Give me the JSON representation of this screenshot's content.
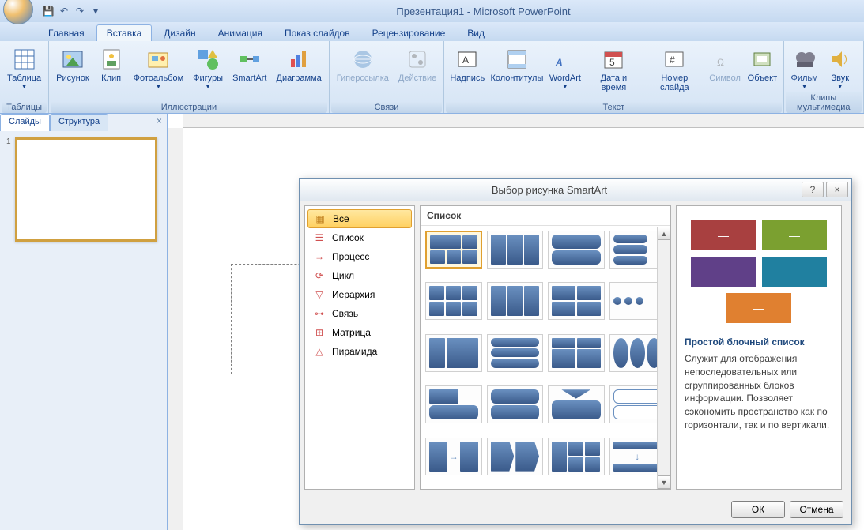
{
  "app_title": "Презентация1 - Microsoft PowerPoint",
  "qat": {
    "save": "save-icon",
    "undo": "undo-icon",
    "redo": "redo-icon"
  },
  "tabs": [
    "Главная",
    "Вставка",
    "Дизайн",
    "Анимация",
    "Показ слайдов",
    "Рецензирование",
    "Вид"
  ],
  "active_tab": 1,
  "ribbon": {
    "groups": [
      {
        "label": "Таблицы",
        "items": [
          {
            "label": "Таблица",
            "icon": "table-icon",
            "drop": true
          }
        ]
      },
      {
        "label": "Иллюстрации",
        "items": [
          {
            "label": "Рисунок",
            "icon": "picture-icon"
          },
          {
            "label": "Клип",
            "icon": "clip-icon"
          },
          {
            "label": "Фотоальбом",
            "icon": "photoalbum-icon",
            "drop": true
          },
          {
            "label": "Фигуры",
            "icon": "shapes-icon",
            "drop": true
          },
          {
            "label": "SmartArt",
            "icon": "smartart-icon"
          },
          {
            "label": "Диаграмма",
            "icon": "chart-icon"
          }
        ]
      },
      {
        "label": "Связи",
        "items": [
          {
            "label": "Гиперссылка",
            "icon": "hyperlink-icon",
            "disabled": true
          },
          {
            "label": "Действие",
            "icon": "action-icon",
            "disabled": true
          }
        ]
      },
      {
        "label": "Текст",
        "items": [
          {
            "label": "Надпись",
            "icon": "textbox-icon"
          },
          {
            "label": "Колонтитулы",
            "icon": "headerfooter-icon"
          },
          {
            "label": "WordArt",
            "icon": "wordart-icon",
            "drop": true
          },
          {
            "label": "Дата и время",
            "icon": "datetime-icon"
          },
          {
            "label": "Номер слайда",
            "icon": "slidenumber-icon"
          },
          {
            "label": "Символ",
            "icon": "symbol-icon",
            "disabled": true
          },
          {
            "label": "Объект",
            "icon": "object-icon"
          }
        ]
      },
      {
        "label": "Клипы мультимедиа",
        "items": [
          {
            "label": "Фильм",
            "icon": "movie-icon",
            "drop": true
          },
          {
            "label": "Звук",
            "icon": "sound-icon",
            "drop": true
          }
        ]
      }
    ]
  },
  "panel": {
    "tabs": [
      "Слайды",
      "Структура"
    ],
    "active": 0,
    "slide_number": "1"
  },
  "dialog": {
    "title": "Выбор рисунка SmartArt",
    "help": "?",
    "close": "×",
    "categories": [
      "Все",
      "Список",
      "Процесс",
      "Цикл",
      "Иерархия",
      "Связь",
      "Матрица",
      "Пирамида"
    ],
    "selected_category": 0,
    "gallery_header": "Список",
    "preview": {
      "title": "Простой блочный список",
      "desc": "Служит для отображения непоследовательных или сгруппированных блоков информации. Позволяет сэкономить пространство как по горизонтали, так и по вертикали.",
      "colors": [
        "#a84040",
        "#7ba030",
        "#604088",
        "#2080a0",
        "#e08030"
      ]
    },
    "buttons": {
      "ok": "ОК",
      "cancel": "Отмена"
    }
  }
}
